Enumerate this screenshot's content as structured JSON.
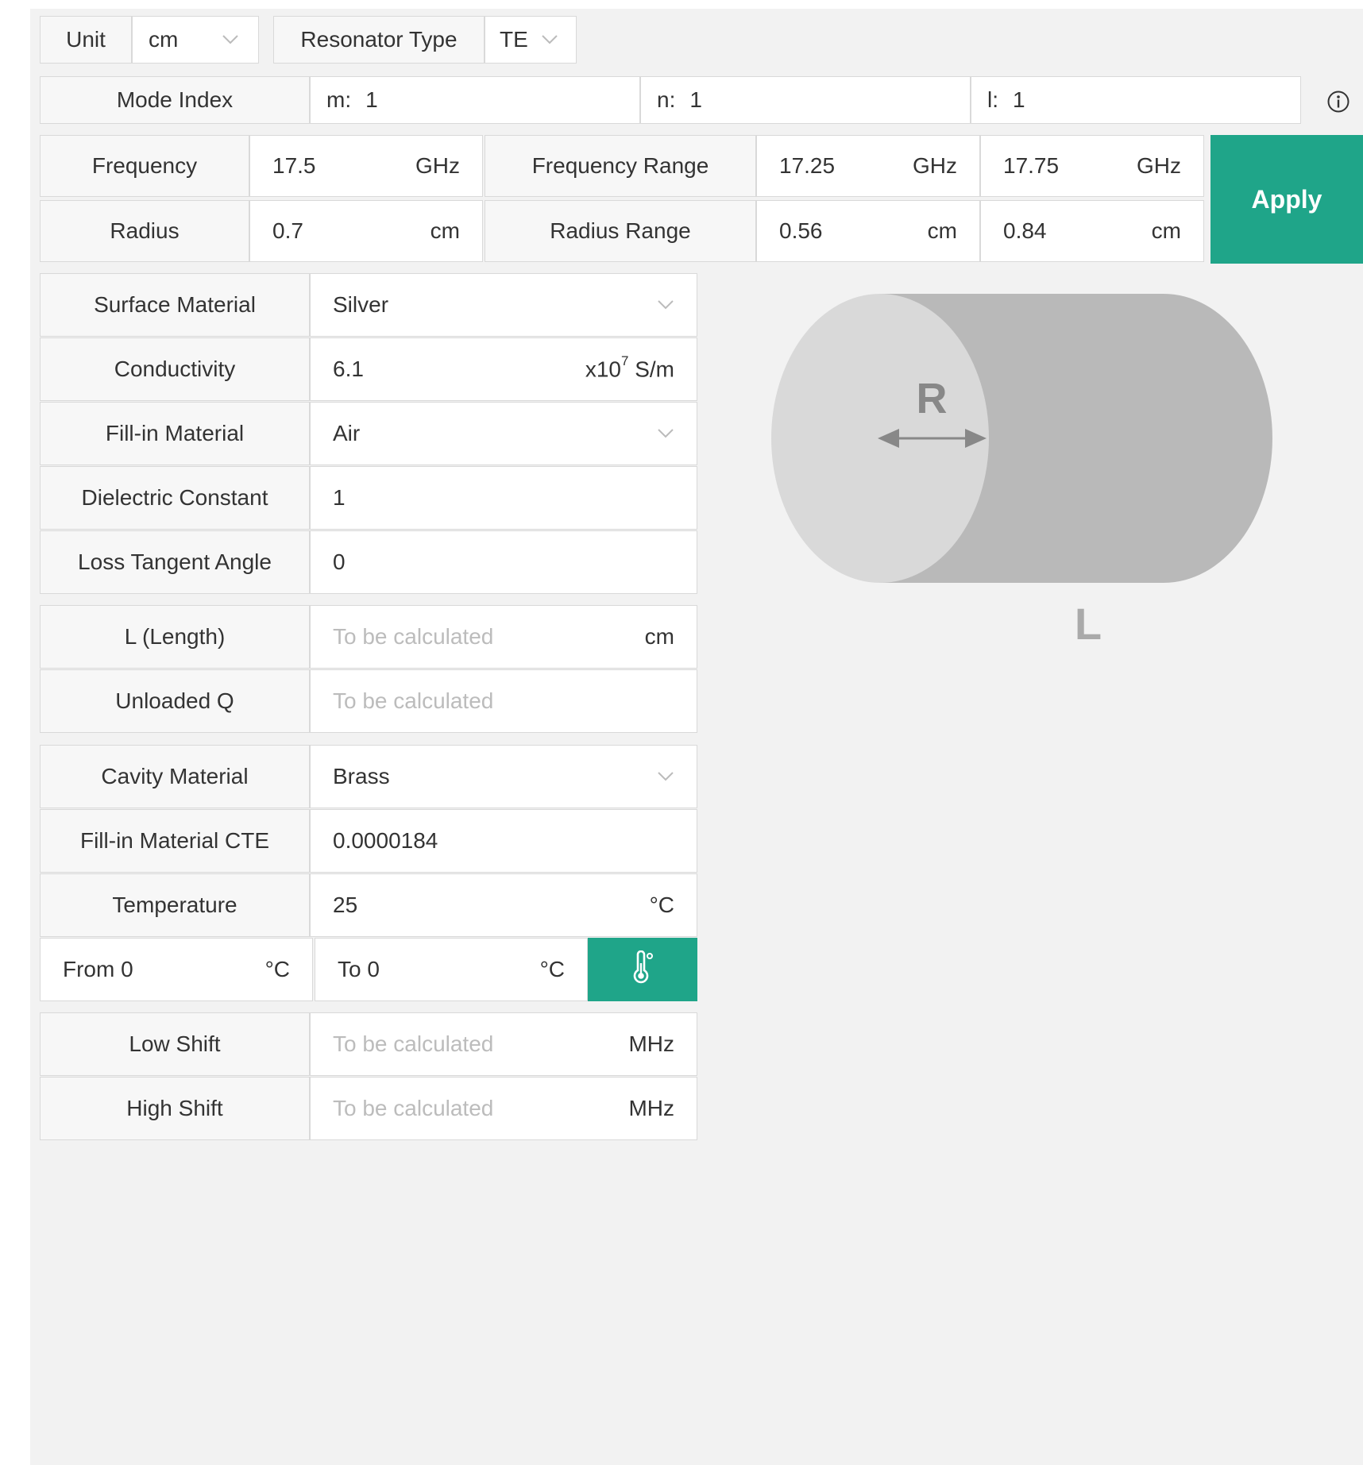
{
  "unit": {
    "label": "Unit",
    "value": "cm"
  },
  "resonator_type": {
    "label": "Resonator Type",
    "value": "TE"
  },
  "mode_index": {
    "label": "Mode Index",
    "m": {
      "prefix": "m:",
      "value": "1"
    },
    "n": {
      "prefix": "n:",
      "value": "1"
    },
    "l": {
      "prefix": "l:",
      "value": "1"
    }
  },
  "frequency": {
    "label": "Frequency",
    "value": "17.5",
    "unit": "GHz"
  },
  "frequency_range": {
    "label": "Frequency Range",
    "low": "17.25",
    "high": "17.75",
    "unit": "GHz"
  },
  "radius": {
    "label": "Radius",
    "value": "0.7",
    "unit": "cm"
  },
  "radius_range": {
    "label": "Radius Range",
    "low": "0.56",
    "high": "0.84",
    "unit": "cm"
  },
  "apply_label": "Apply",
  "surface_material": {
    "label": "Surface Material",
    "value": "Silver"
  },
  "conductivity": {
    "label": "Conductivity",
    "value": "6.1",
    "unit_prefix": "x10",
    "unit_exp": "7",
    "unit_suffix": " S/m"
  },
  "fill_material": {
    "label": "Fill-in Material",
    "value": "Air"
  },
  "dielectric_constant": {
    "label": "Dielectric Constant",
    "value": "1"
  },
  "loss_tangent": {
    "label": "Loss Tangent Angle",
    "value": "0"
  },
  "length": {
    "label": "L (Length)",
    "placeholder": "To be calculated",
    "unit": "cm"
  },
  "unloaded_q": {
    "label": "Unloaded Q",
    "placeholder": "To be calculated"
  },
  "cavity_material": {
    "label": "Cavity Material",
    "value": "Brass"
  },
  "fill_cte": {
    "label": "Fill-in Material CTE",
    "value": "0.0000184"
  },
  "temperature": {
    "label": "Temperature",
    "value": "25",
    "unit": "°C"
  },
  "temp_range": {
    "from_prefix": "From",
    "from_value": "0",
    "from_unit": "°C",
    "to_prefix": "To",
    "to_value": "0",
    "to_unit": "°C"
  },
  "low_shift": {
    "label": "Low Shift",
    "placeholder": "To be calculated",
    "unit": "MHz"
  },
  "high_shift": {
    "label": "High Shift",
    "placeholder": "To be calculated",
    "unit": "MHz"
  },
  "diagram": {
    "radius_label": "R",
    "length_label": "L"
  },
  "colors": {
    "accent": "#1fa589",
    "panel_bg": "#f2f2f2",
    "cylinder_body": "#b9b9b9",
    "cylinder_face": "#d9d9d9"
  },
  "icons": {
    "info": "info-icon",
    "thermometer": "thermometer-icon",
    "dropdown": "chevron-down-icon"
  }
}
